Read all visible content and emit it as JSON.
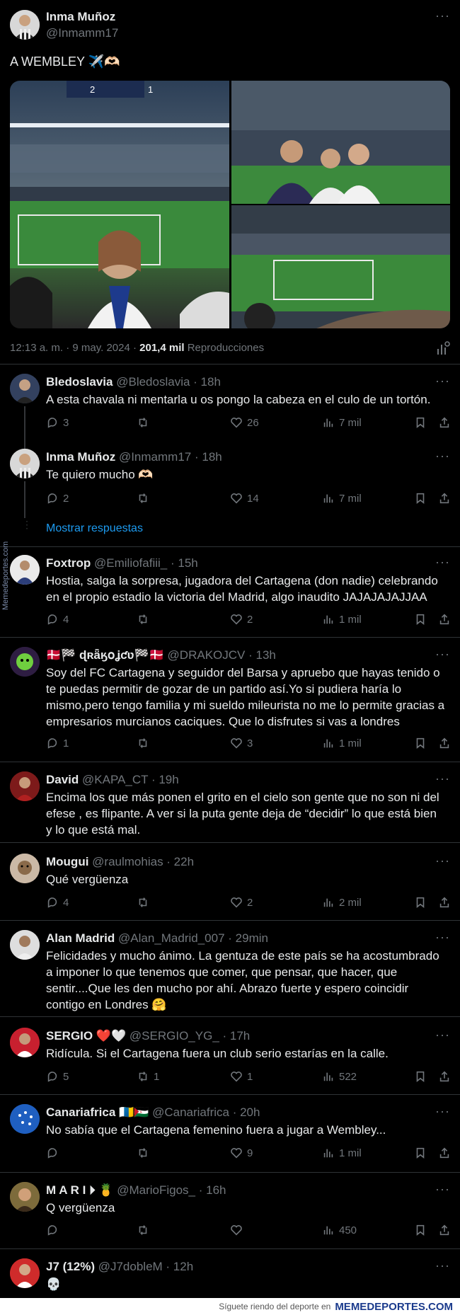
{
  "tweet": {
    "author_name": "Inma Muñoz",
    "author_handle": "@Inmamm17",
    "text": "A WEMBLEY ✈️🫶🏻",
    "timestamp": "12:13 a. m. · 9 may. 2024 ·",
    "views_count": "201,4 mil",
    "views_label": "Reproducciones",
    "scoreboard_left": "2",
    "scoreboard_right": "1"
  },
  "replies": [
    {
      "name": "Bledoslavia",
      "handle": "@Bledoslavia",
      "time": "· 18h",
      "text": "A esta chavala ni mentarla u os pongo la cabeza en el culo de un tortón.",
      "replies": "3",
      "retweets": "",
      "likes": "26",
      "views": "7 mil"
    },
    {
      "name": "Inma Muñoz",
      "handle": "@Inmamm17",
      "time": "· 18h",
      "text": "Te quiero mucho 🫶🏻",
      "replies": "2",
      "retweets": "",
      "likes": "14",
      "views": "7 mil"
    },
    {
      "name": "Foxtrop",
      "handle": "@Emiliofafiii_",
      "time": "· 15h",
      "text": "Hostia, salga la sorpresa, jugadora del Cartagena (don nadie) celebrando en el propio estadio la victoria del Madrid, algo inaudito JAJAJAJAJJAA",
      "replies": "4",
      "retweets": "",
      "likes": "2",
      "views": "1 mil"
    },
    {
      "name": "🇩🇰🏁 ɖʀǟӄօʝƈʋ🏁🇩🇰",
      "handle": "@DRAKOJCV",
      "time": "· 13h",
      "text": "Soy del FC Cartagena y seguidor del Barsa y apruebo que hayas tenido o te puedas permitir de gozar de un partido así.Yo si pudiera haría lo mismo,pero tengo familia y mi sueldo mileurista no me lo permite gracias a empresarios murcianos caciques. Que lo disfrutes si vas a londres",
      "replies": "1",
      "retweets": "",
      "likes": "3",
      "views": "1 mil"
    },
    {
      "name": "David",
      "handle": "@KAPA_CT",
      "time": "· 19h",
      "text": "Encima los que más ponen el grito en el cielo son gente que no son ni del efese , es flipante. A ver si la puta gente deja de “decidir” lo que está bien y lo que está mal.",
      "replies": "",
      "retweets": "",
      "likes": "",
      "views": ""
    },
    {
      "name": "Mougui",
      "handle": "@raulmohias",
      "time": "· 22h",
      "text": "Qué vergüenza",
      "replies": "4",
      "retweets": "",
      "likes": "2",
      "views": "2 mil"
    },
    {
      "name": "Alan Madrid",
      "handle": "@Alan_Madrid_007",
      "time": "· 29min",
      "text": "Felicidades y mucho ánimo. La gentuza de este país se ha acostumbrado a imponer lo que tenemos que comer, que pensar, que hacer, que sentir....Que les den mucho por ahí. Abrazo fuerte y espero coincidir contigo en Londres 🤗",
      "replies": "",
      "retweets": "",
      "likes": "",
      "views": ""
    },
    {
      "name": "SERGIO ❤️🤍",
      "handle": "@SERGIO_YG_",
      "time": "· 17h",
      "text": "Ridícula. Si el Cartagena fuera un club serio estarías en la calle.",
      "replies": "5",
      "retweets": "1",
      "likes": "1",
      "views": "522"
    },
    {
      "name": "Canariafrica 🇮🇨🇪🇭",
      "handle": "@Canariafrica",
      "time": "· 20h",
      "text": "No sabía que el Cartagena femenino fuera a jugar a Wembley...",
      "replies": "",
      "retweets": "",
      "likes": "9",
      "views": "1 mil"
    },
    {
      "name": "M A R I ⏵ 🍍",
      "handle": "@MarioFigos_",
      "time": "· 16h",
      "text": "Q vergüenza",
      "replies": "",
      "retweets": "",
      "likes": "",
      "views": "450"
    },
    {
      "name": "J7 (12%)",
      "handle": "@J7dobleM",
      "time": "· 12h",
      "text": "💀",
      "replies": "",
      "retweets": "",
      "likes": "",
      "views": ""
    }
  ],
  "show_replies_label": "Mostrar respuestas",
  "watermark": {
    "side": "Memedeportes.com",
    "footer_text": "Síguete riendo del deporte en",
    "footer_brand": "MEMEDEPORTES.COM"
  },
  "colors": {
    "background": "#000000",
    "text": "#e7e9ea",
    "muted": "#71767b",
    "link": "#1d9bf0",
    "divider": "#2f3336"
  }
}
